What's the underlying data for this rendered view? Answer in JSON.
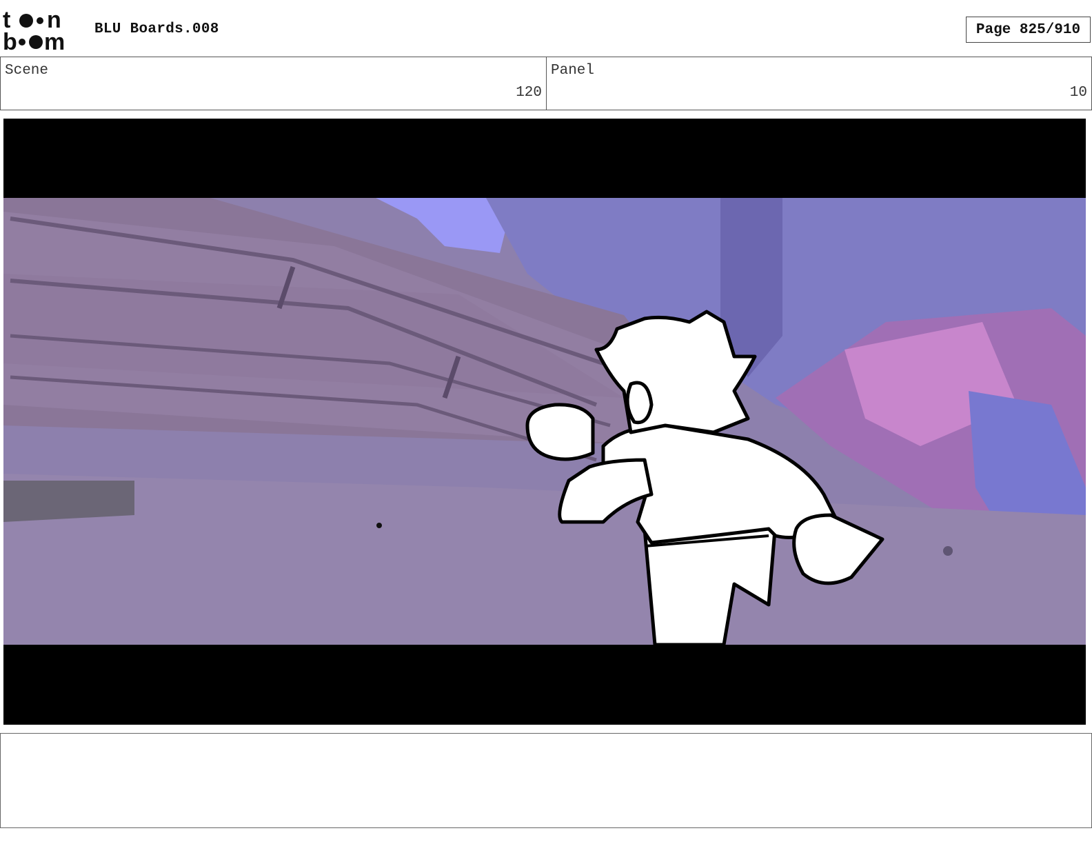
{
  "header": {
    "logo_text_top": "toon",
    "logo_text_bottom": "boom",
    "document_title": "BLU Boards.008",
    "page_indicator": "Page 825/910"
  },
  "scene": {
    "label": "Scene",
    "value": "120"
  },
  "panel": {
    "label": "Panel",
    "value": "10"
  },
  "frame": {
    "letterbox_color": "#000000",
    "tint_color": "#8d7fb0",
    "sky_color": "#9a98f5"
  },
  "notes": {
    "text": ""
  }
}
